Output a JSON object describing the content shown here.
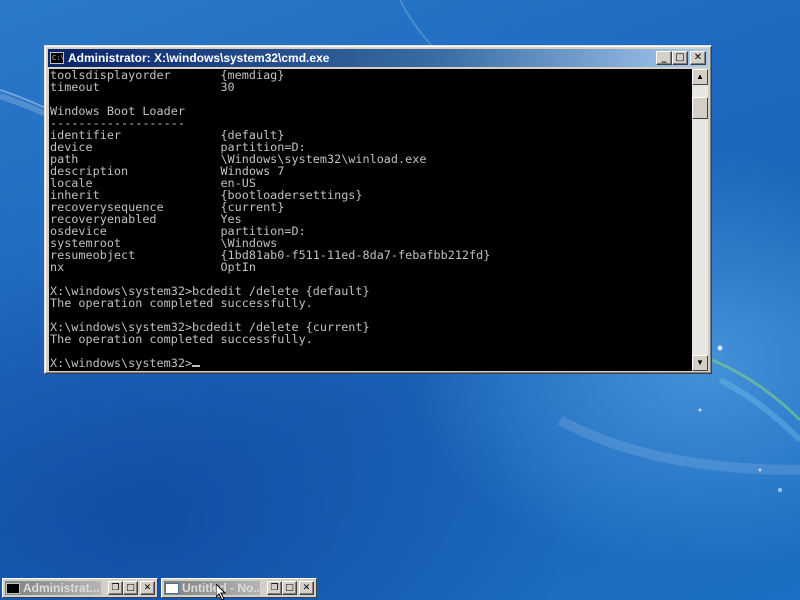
{
  "window": {
    "title": "Administrator: X:\\windows\\system32\\cmd.exe",
    "icon": "cmd-icon",
    "controls": {
      "minimize": "_",
      "maximize": "□",
      "close": "✕"
    }
  },
  "console": {
    "text": "toolsdisplayorder       {memdiag}\ntimeout                 30\n\nWindows Boot Loader\n-------------------\nidentifier              {default}\ndevice                  partition=D:\npath                    \\Windows\\system32\\winload.exe\ndescription             Windows 7\nlocale                  en-US\ninherit                 {bootloadersettings}\nrecoverysequence        {current}\nrecoveryenabled         Yes\nosdevice                partition=D:\nsystemroot              \\Windows\nresumeobject            {1bd81ab0-f511-11ed-8da7-febafbb212fd}\nnx                      OptIn\n\nX:\\windows\\system32>bcdedit /delete {default}\nThe operation completed successfully.\n\nX:\\windows\\system32>bcdedit /delete {current}\nThe operation completed successfully.\n\n",
    "prompt": "X:\\windows\\system32>",
    "text_color": "#c0c0c0",
    "background_color": "#000000"
  },
  "scrollbar": {
    "up_arrow": "▲",
    "down_arrow": "▼"
  },
  "taskbar": {
    "items": [
      {
        "label": "Administrat...",
        "icon": "cmd-icon",
        "restore": "❐",
        "maximize": "□",
        "close": "✕"
      },
      {
        "label": "Untitled - No...",
        "icon": "notepad-icon",
        "restore": "❐",
        "maximize": "□",
        "close": "✕"
      }
    ]
  },
  "colors": {
    "titlebar_start": "#0a246a",
    "titlebar_end": "#a6caf0",
    "desktop_blue": "#1f6ac0"
  }
}
